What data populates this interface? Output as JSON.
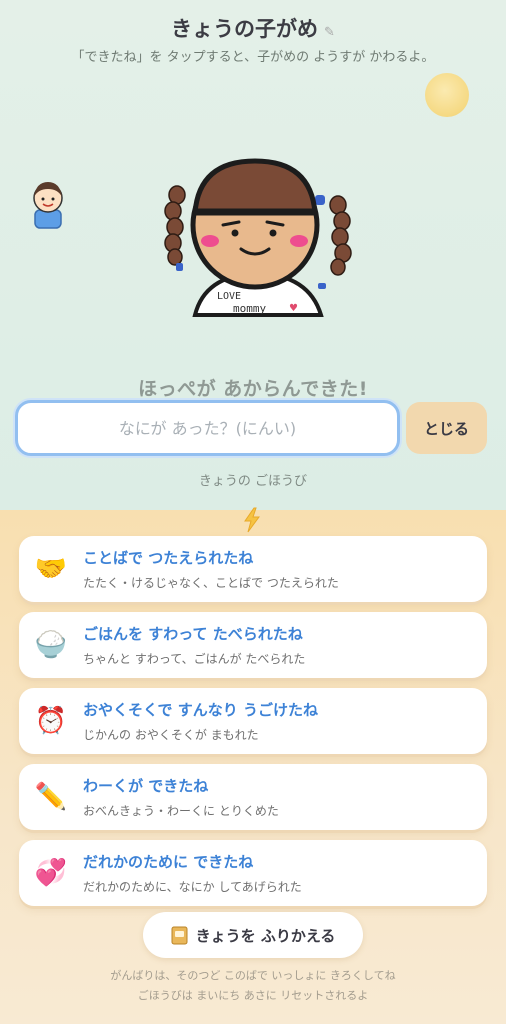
{
  "header": {
    "title": "きょうの子がめ",
    "edit_icon": "pencil-icon",
    "subtitle": "「できたね」を タップすると、子がめの ようすが かわるよ。"
  },
  "scene": {
    "sun_icon": "sun-icon",
    "small_avatar_icon": "child-avatar-icon",
    "character_shirt_text": "LOVE mommy",
    "headline": "ほっぺが あからんできた!"
  },
  "memo": {
    "placeholder": "なにが あった？(にんい)",
    "value": "",
    "close_label": "とじる"
  },
  "rewards": {
    "label": "きょうの ごほうび",
    "divider_icon": "lightning-icon"
  },
  "cards": [
    {
      "icon": "handshake-icon",
      "glyph": "🤝",
      "title": "ことばで つたえられたね",
      "desc": "たたく・けるじゃなく、ことばで つたえられた"
    },
    {
      "icon": "rice-bowl-icon",
      "glyph": "🍚",
      "title": "ごはんを すわって たべられたね",
      "desc": "ちゃんと すわって、ごはんが たべられた"
    },
    {
      "icon": "alarm-clock-icon",
      "glyph": "⏰",
      "title": "おやくそくで すんなり うごけたね",
      "desc": "じかんの おやくそくが まもれた"
    },
    {
      "icon": "pencil-icon",
      "glyph": "✏️",
      "title": "わーくが できたね",
      "desc": "おべんきょう・わーくに とりくめた"
    },
    {
      "icon": "heart-icon",
      "glyph": "💞",
      "title": "だれかのために できたね",
      "desc": "だれかのために、なにか してあげられた"
    }
  ],
  "review": {
    "icon": "notebook-icon",
    "label": "きょうを ふりかえる"
  },
  "footer": {
    "line1": "がんばりは、そのつど このばで いっしょに きろくしてね",
    "line2": "ごほうびは まいにち あさに リセットされるよ"
  },
  "colors": {
    "top_background": "#e4f0e8",
    "bottom_background": "#f8dfb0",
    "accent_blue": "#3d82d6",
    "input_border": "#92bff0",
    "close_button": "#f2d8ae"
  }
}
